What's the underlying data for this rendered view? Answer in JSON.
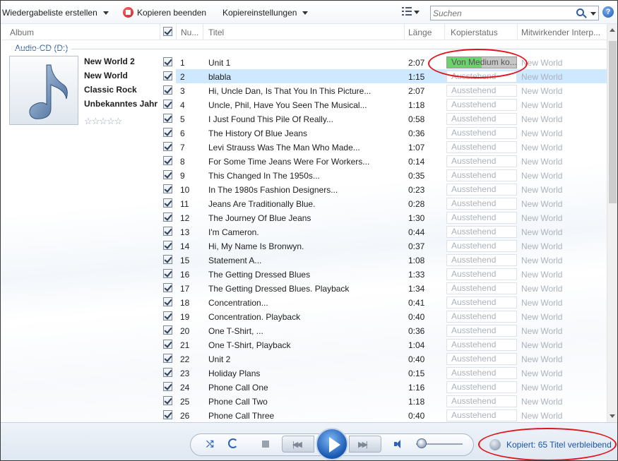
{
  "toolbar": {
    "create_playlist": "Wiedergabeliste erstellen",
    "stop_rip": "Kopieren beenden",
    "rip_settings": "Kopiereinstellungen",
    "search_placeholder": "Suchen",
    "help": "?"
  },
  "columns": {
    "album": "Album",
    "number": "Nu...",
    "title": "Titel",
    "length": "Länge",
    "rip_status": "Kopierstatus",
    "contributing_artist": "Mitwirkender Interp..."
  },
  "group_label": "Audio-CD (D:)",
  "album": {
    "lines": [
      "New World 2",
      "New World",
      "Classic Rock",
      "Unbekanntes Jahr"
    ],
    "rating_stars": 0,
    "icon": "music-note-icon"
  },
  "tracks": [
    {
      "num": "1",
      "title": "Unit 1",
      "length": "2:07",
      "status": "Von Medium ko...",
      "artist": "New World",
      "progress": 0.5
    },
    {
      "num": "2",
      "title": "blabla",
      "length": "1:15",
      "status": "Ausstehend",
      "artist": "New World"
    },
    {
      "num": "3",
      "title": "Hi, Uncle Dan, Is That You In This Picture...",
      "length": "2:07",
      "status": "Ausstehend",
      "artist": "New World"
    },
    {
      "num": "4",
      "title": "Uncle, Phil, Have You Seen The Musical...",
      "length": "1:18",
      "status": "Ausstehend",
      "artist": "New World"
    },
    {
      "num": "5",
      "title": "I Just Found This Pile Of Really...",
      "length": "0:58",
      "status": "Ausstehend",
      "artist": "New World"
    },
    {
      "num": "6",
      "title": "The History Of Blue Jeans",
      "length": "0:36",
      "status": "Ausstehend",
      "artist": "New World"
    },
    {
      "num": "7",
      "title": "Levi Strauss Was The Man Who Made...",
      "length": "1:07",
      "status": "Ausstehend",
      "artist": "New World"
    },
    {
      "num": "8",
      "title": "For Some Time Jeans Were For Workers...",
      "length": "0:14",
      "status": "Ausstehend",
      "artist": "New World"
    },
    {
      "num": "9",
      "title": "This Changed In The 1950s...",
      "length": "0:35",
      "status": "Ausstehend",
      "artist": "New World"
    },
    {
      "num": "10",
      "title": "In The 1980s Fashion Designers...",
      "length": "0:23",
      "status": "Ausstehend",
      "artist": "New World"
    },
    {
      "num": "11",
      "title": "Jeans Are Traditionally Blue.",
      "length": "0:28",
      "status": "Ausstehend",
      "artist": "New World"
    },
    {
      "num": "12",
      "title": "The Journey Of Blue Jeans",
      "length": "1:30",
      "status": "Ausstehend",
      "artist": "New World"
    },
    {
      "num": "13",
      "title": "I'm Cameron.",
      "length": "0:44",
      "status": "Ausstehend",
      "artist": "New World"
    },
    {
      "num": "14",
      "title": "Hi, My Name Is Bronwyn.",
      "length": "0:37",
      "status": "Ausstehend",
      "artist": "New World"
    },
    {
      "num": "15",
      "title": "Statement A...",
      "length": "1:08",
      "status": "Ausstehend",
      "artist": "New World"
    },
    {
      "num": "16",
      "title": "The Getting Dressed Blues",
      "length": "1:33",
      "status": "Ausstehend",
      "artist": "New World"
    },
    {
      "num": "17",
      "title": "The Getting Dressed Blues. Playback",
      "length": "1:34",
      "status": "Ausstehend",
      "artist": "New World"
    },
    {
      "num": "18",
      "title": "Concentration...",
      "length": "0:41",
      "status": "Ausstehend",
      "artist": "New World"
    },
    {
      "num": "19",
      "title": "Concentration. Playback",
      "length": "0:40",
      "status": "Ausstehend",
      "artist": "New World"
    },
    {
      "num": "20",
      "title": "One T-Shirt, ...",
      "length": "0:36",
      "status": "Ausstehend",
      "artist": "New World"
    },
    {
      "num": "21",
      "title": "One T-Shirt, Playback",
      "length": "1:04",
      "status": "Ausstehend",
      "artist": "New World"
    },
    {
      "num": "22",
      "title": "Unit 2",
      "length": "0:40",
      "status": "Ausstehend",
      "artist": "New World"
    },
    {
      "num": "23",
      "title": "Holiday Plans",
      "length": "0:15",
      "status": "Ausstehend",
      "artist": "New World"
    },
    {
      "num": "24",
      "title": "Phone Call One",
      "length": "1:16",
      "status": "Ausstehend",
      "artist": "New World"
    },
    {
      "num": "25",
      "title": "Phone Call Two",
      "length": "1:18",
      "status": "Ausstehend",
      "artist": "New World"
    },
    {
      "num": "26",
      "title": "Phone Call Three",
      "length": "0:40",
      "status": "Ausstehend",
      "artist": "New World"
    }
  ],
  "selected_track": "2",
  "player": {
    "status_text": "Kopiert: 65 Titel verbleibend",
    "volume": 0.05
  },
  "colors": {
    "accent": "#1b55a8",
    "selection": "#cde8ff",
    "progress": "#6bd36b",
    "annotation": "#e0141c"
  }
}
